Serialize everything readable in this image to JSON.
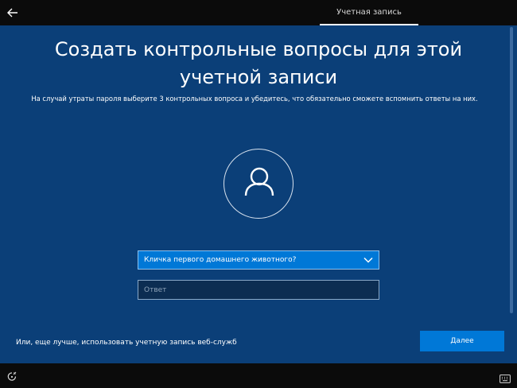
{
  "header": {
    "tab_label": "Учетная запись"
  },
  "main": {
    "title_line1": "Создать контрольные вопросы для этой",
    "title_line2": "учетной записи",
    "subtitle": "На случай утраты пароля выберите 3 контрольных вопроса и убедитесь, что обязательно сможете вспомнить ответы на них.",
    "question_select": {
      "selected": "Кличка первого домашнего животного?"
    },
    "answer_input": {
      "value": "",
      "placeholder": "Ответ"
    },
    "web_services_link": "Или, еще лучше, использовать учетную запись веб-служб",
    "next_button": "Далее"
  },
  "icons": {
    "back": "back-arrow-icon",
    "avatar": "user-icon",
    "dropdown": "chevron-down-icon",
    "accessibility": "ease-of-access-icon",
    "keyboard": "keyboard-icon"
  },
  "colors": {
    "panel": "#0b3f78",
    "accent": "#0078d7",
    "bar": "#0b0b0b"
  }
}
